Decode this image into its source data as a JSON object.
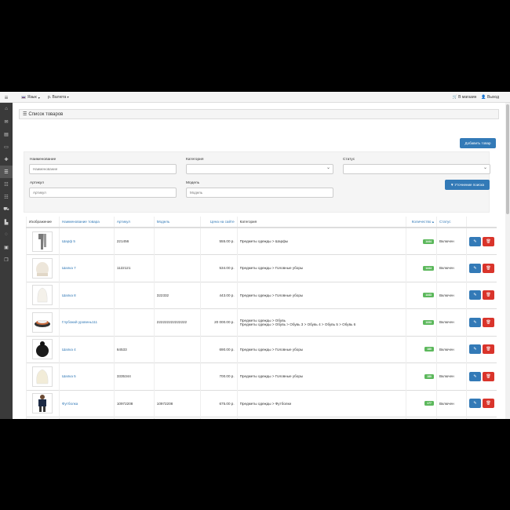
{
  "topbar": {
    "lang_label": "Язык",
    "currency_label": "р. Валюта",
    "store_label": "В магазин",
    "logout_label": "Выход"
  },
  "panel": {
    "title": "Список товаров"
  },
  "toolbar": {
    "add_label": "Добавить товар"
  },
  "filters": {
    "name_label": "Наименование",
    "name_placeholder": "Наименование",
    "category_label": "Категория",
    "status_label": "Статус",
    "sku_label": "Артикул",
    "sku_placeholder": "Артикул",
    "model_label": "Модель",
    "model_placeholder": "Модель",
    "submit_label": "Уточнение поиска"
  },
  "table": {
    "headers": {
      "image": "Изображение",
      "name": "Наименование товара",
      "sku": "Артикул",
      "model": "Модель",
      "price": "Цена на сайте",
      "category": "Категория",
      "quantity": "Количество",
      "status": "Статус"
    },
    "rows": [
      {
        "name": "Шарф 5",
        "sku": "221456",
        "model": "",
        "price": "555.00 р.",
        "cat1": "Предметы одежды  >  Шарфы",
        "cat2": "",
        "qty": "1444",
        "status": "Включен"
      },
      {
        "name": "Шапка 7",
        "sku": "1122121",
        "model": "",
        "price": "534.00 р.",
        "cat1": "Предметы одежды  >  Головные уборы",
        "cat2": "",
        "qty": "1444",
        "status": "Включен"
      },
      {
        "name": "Шапка 8",
        "sku": "",
        "model": "322332",
        "price": "443.00 р.",
        "cat1": "Предметы одежды  >  Головные уборы",
        "cat2": "",
        "qty": "1443",
        "status": "Включен"
      },
      {
        "name": "Глубокий уровень111",
        "sku": "",
        "model": "222222222222222",
        "price": "20 000.00 р.",
        "cat1": "Предметы одежды  >  Обувь",
        "cat2": "Предметы одежды  >  Обувь  >  Обувь 3  >  Обувь 4  >  Обувь 5  >  Обувь 6",
        "qty": "1333",
        "status": "Включен"
      },
      {
        "name": "Шапка 4",
        "sku": "64533",
        "model": "",
        "price": "690.00 р.",
        "cat1": "Предметы одежды  >  Головные уборы",
        "cat2": "",
        "qty": "180",
        "status": "Включен"
      },
      {
        "name": "Шапка 5",
        "sku": "3335344",
        "model": "",
        "price": "700.00 р.",
        "cat1": "Предметы одежды  >  Головные уборы",
        "cat2": "",
        "qty": "180",
        "status": "Включен"
      },
      {
        "name": "Футболка",
        "sku": "10972208",
        "model": "10972208",
        "price": "675.00 р.",
        "cat1": "Предметы одежды  >  Футболки",
        "cat2": "",
        "qty": "177",
        "status": "Включен"
      }
    ]
  }
}
